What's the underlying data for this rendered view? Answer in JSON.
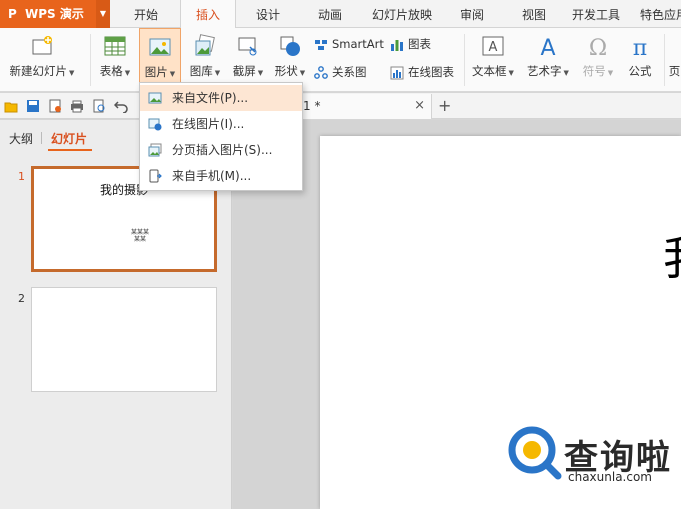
{
  "app": {
    "name": "WPS 演示",
    "logo_glyph": "P"
  },
  "menu_tabs": [
    "开始",
    "插入",
    "设计",
    "动画",
    "幻灯片放映",
    "审阅",
    "视图",
    "开发工具",
    "特色应用"
  ],
  "active_tab": "插入",
  "ribbon": {
    "new_slide": "新建幻灯片",
    "table": "表格",
    "picture": "图片",
    "gallery": "图库",
    "screenshot": "截屏",
    "shapes": "形状",
    "smartart": "SmartArt",
    "chart": "图表",
    "relation_chart": "关系图",
    "online_chart": "在线图表",
    "textbox": "文本框",
    "wordart": "艺术字",
    "symbol": "符号",
    "formula": "公式",
    "next_cut": "页"
  },
  "doc_tab": {
    "title": "1 *",
    "close": "×",
    "new": "+"
  },
  "left_panel": {
    "outline_tab": "大纲",
    "slides_tab": "幻灯片",
    "slides": [
      {
        "number": "1",
        "title": "我的摄影",
        "subtitle": "某某某\n某某"
      },
      {
        "number": "2",
        "title": "",
        "subtitle": ""
      }
    ]
  },
  "slide": {
    "title_fragment": "我"
  },
  "dropdown": {
    "items": [
      {
        "label": "来自文件(P)...",
        "icon": "image-file-icon"
      },
      {
        "label": "在线图片(I)...",
        "icon": "online-image-icon"
      },
      {
        "label": "分页插入图片(S)...",
        "icon": "paged-image-icon"
      },
      {
        "label": "来自手机(M)...",
        "icon": "phone-icon"
      }
    ]
  },
  "watermark": {
    "brand": "查询啦",
    "url": "chaxunla.com"
  },
  "colors": {
    "accent": "#e8641c",
    "active_text": "#d9501f",
    "hover": "#fde6d3"
  }
}
